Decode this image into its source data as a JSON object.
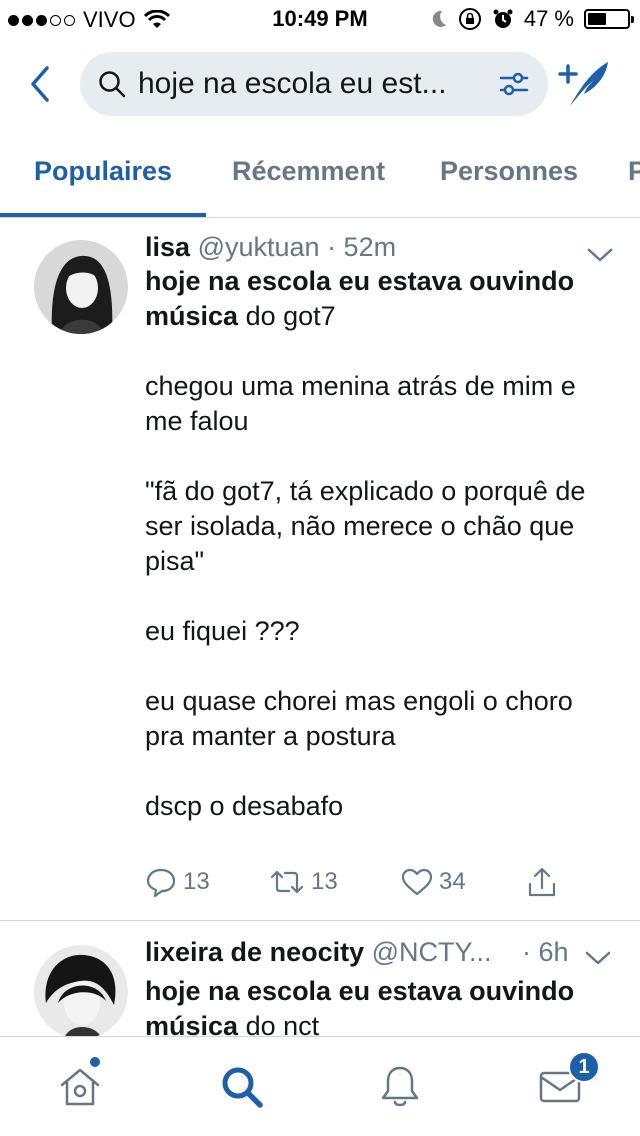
{
  "status_bar": {
    "carrier": "VIVO",
    "time": "10:49 PM",
    "battery_percent": "47 %",
    "battery_level": 0.47
  },
  "search": {
    "query": "hoje na escola eu est..."
  },
  "tabs": [
    {
      "label": "Populaires",
      "active": true
    },
    {
      "label": "Récemment",
      "active": false
    },
    {
      "label": "Personnes",
      "active": false
    },
    {
      "label": "P",
      "active": false
    }
  ],
  "tweets": [
    {
      "name": "lisa",
      "handle": "@yuktuan",
      "time": "· 52m",
      "text_bold": "hoje na escola eu estava ouvindo música",
      "text_rest": " do got7\n\nchegou uma menina atrás de mim e me falou\n\n\"fã do got7, tá explicado o porquê de ser isolada, não merece o chão que pisa\"\n\neu fiquei ???\n\neu quase chorei mas engoli o choro pra manter a postura\n\ndscp o desabafo",
      "replies": "13",
      "retweets": "13",
      "likes": "34"
    },
    {
      "name": "lixeira de neocity",
      "handle": "@NCTY...",
      "time": "· 6h",
      "text_bold": "hoje na escola eu estava ouvindo música",
      "text_rest": " do nct"
    }
  ],
  "nav": {
    "messages_badge": "1"
  },
  "colors": {
    "accent": "#1d5fa8",
    "secondary_text": "#657786",
    "search_bg": "#e6ecf0"
  }
}
